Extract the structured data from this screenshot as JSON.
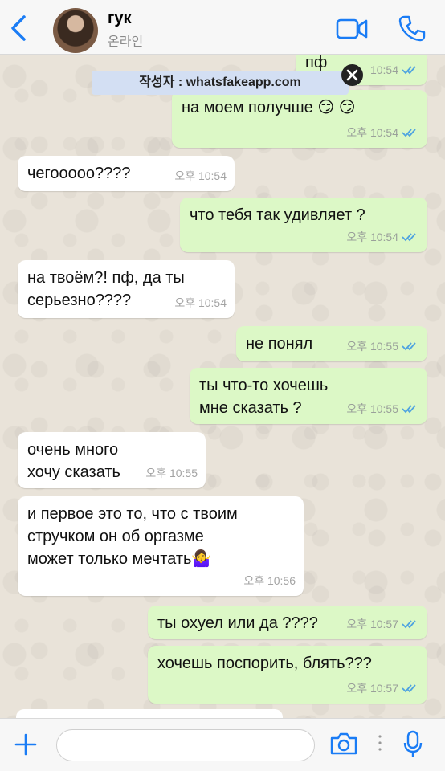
{
  "header": {
    "contact_name": "гук",
    "contact_status": "온라인"
  },
  "watermark": {
    "text": "작성자 : whatsfakeapp.com"
  },
  "messages": [
    {
      "dir": "out",
      "text": "пф",
      "time": "10:54",
      "ticks": true
    },
    {
      "dir": "out",
      "text": "на моем получше 😏 😏",
      "time": "오후 10:54",
      "ticks": true
    },
    {
      "dir": "in",
      "text": "чегооооо????",
      "time": "오후 10:54"
    },
    {
      "dir": "out",
      "text": "что тебя так удивляет ?",
      "time": "오후 10:54",
      "ticks": true
    },
    {
      "dir": "in",
      "text": "на твоём?! пф, да ты\nсерьезно????",
      "time": "오후 10:54"
    },
    {
      "dir": "out",
      "text": "не понял",
      "time": "오후 10:55",
      "ticks": true
    },
    {
      "dir": "out",
      "text": "ты что-то хочешь\nмне сказать ?",
      "time": "오후 10:55",
      "ticks": true
    },
    {
      "dir": "in",
      "text": "очень много\nхочу сказать",
      "time": "오후 10:55"
    },
    {
      "dir": "in",
      "text": "и первое это то, что с твоим\nстручком он об оргазме\nможет только мечтать🤷‍♀️",
      "time": "오후 10:56"
    },
    {
      "dir": "out",
      "text": "ты охуел или да ????",
      "time": "오후 10:57",
      "ticks": true
    },
    {
      "dir": "out",
      "text": "хочешь поспорить, блять???",
      "time": "오후 10:57",
      "ticks": true
    }
  ],
  "colors": {
    "accent": "#1a7cf5",
    "outgoing_bubble": "#dcf8c6",
    "incoming_bubble": "#ffffff",
    "read_ticks": "#4fa3e0"
  },
  "icons": {
    "back": "chevron-left-icon",
    "video": "video-camera-icon",
    "phone": "phone-icon",
    "plus": "plus-icon",
    "camera": "camera-icon",
    "mic": "microphone-icon"
  }
}
